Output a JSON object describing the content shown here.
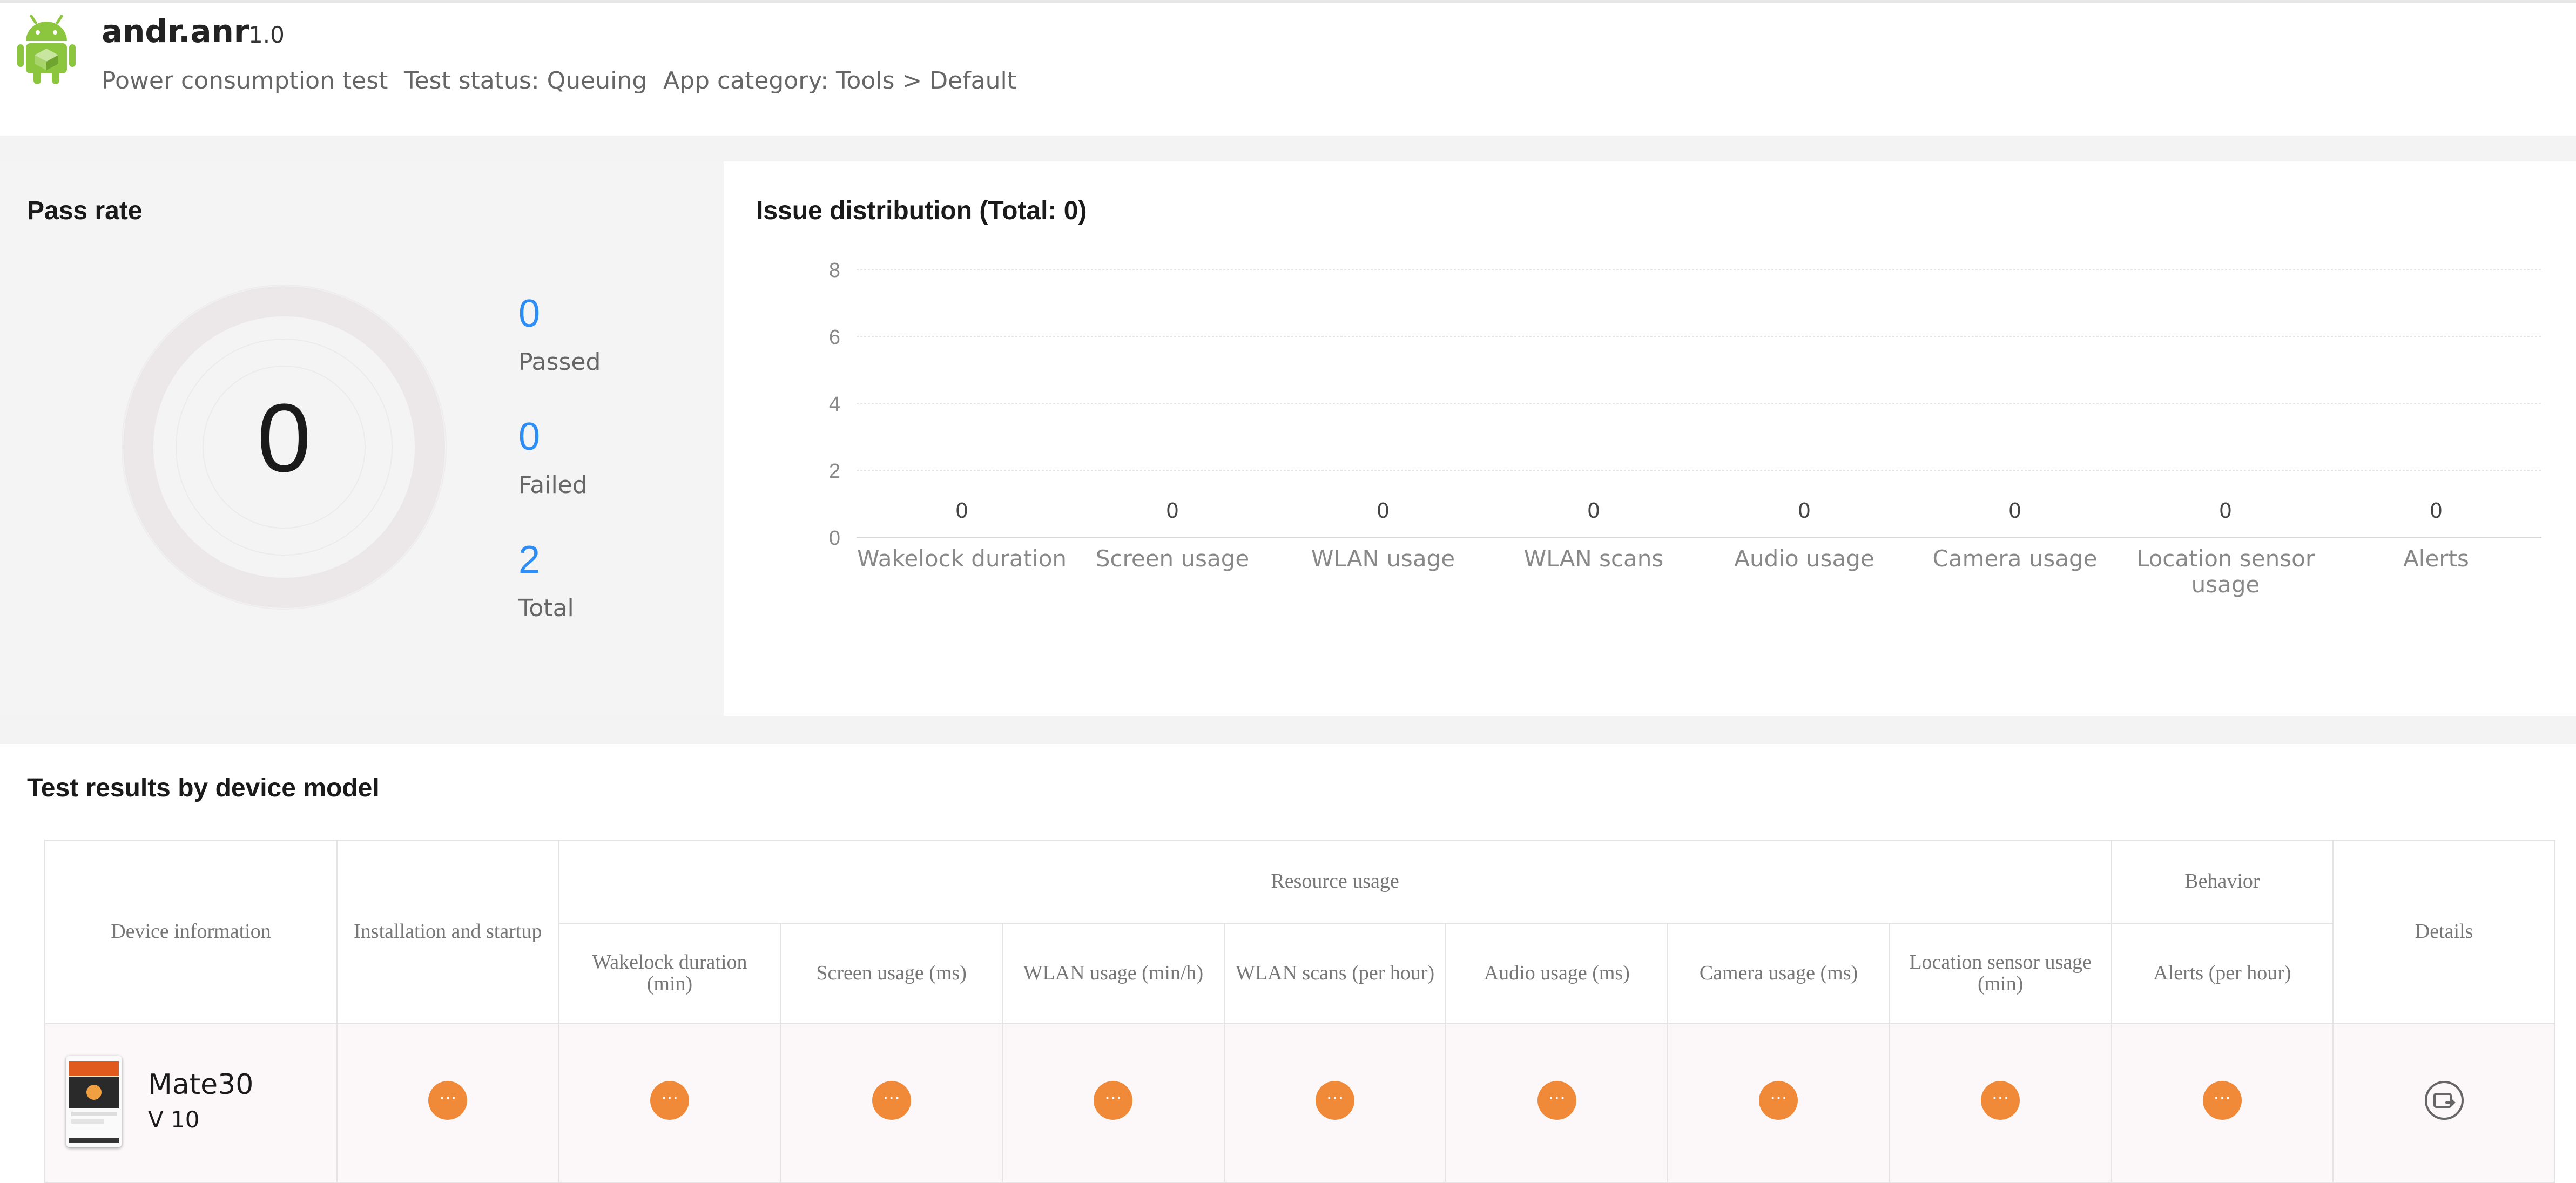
{
  "app": {
    "name": "andr.anr",
    "version": "1.0",
    "test_type": "Power consumption test",
    "test_status": "Test status: Queuing",
    "app_category": "App category: Tools > Default"
  },
  "pass_rate": {
    "title": "Pass rate",
    "rate": "0",
    "passed": "0",
    "passed_label": "Passed",
    "failed": "0",
    "failed_label": "Failed",
    "total": "2",
    "total_label": "Total"
  },
  "issue_chart": {
    "title": "Issue distribution (Total: 0)"
  },
  "chart_data": {
    "type": "bar",
    "title": "Issue distribution (Total: 0)",
    "categories": [
      "Wakelock duration",
      "Screen usage",
      "WLAN usage",
      "WLAN scans",
      "Audio usage",
      "Camera usage",
      "Location sensor usage",
      "Alerts"
    ],
    "values": [
      0,
      0,
      0,
      0,
      0,
      0,
      0,
      0
    ],
    "data_labels": [
      "0",
      "0",
      "0",
      "0",
      "0",
      "0",
      "0",
      "0"
    ],
    "yticks": [
      "0",
      "2",
      "4",
      "6",
      "8"
    ],
    "ylim": [
      0,
      8
    ],
    "grid": true,
    "xlabel": "",
    "ylabel": ""
  },
  "results": {
    "title": "Test results by device model",
    "headers": {
      "device_information": "Device information",
      "installation": "Installation and startup",
      "resource_usage": "Resource usage",
      "behavior": "Behavior",
      "details": "Details",
      "wakelock": "Wakelock duration (min)",
      "screen": "Screen usage (ms)",
      "wlan_usage": "WLAN usage (min/h)",
      "wlan_scans": "WLAN scans (per hour)",
      "audio": "Audio usage (ms)",
      "camera": "Camera usage (ms)",
      "location": "Location sensor usage (min)",
      "alerts": "Alerts (per hour)"
    },
    "rows": [
      {
        "device_name": "Mate30",
        "device_version": "V 10",
        "status_icon": "pending-dots-icon"
      }
    ]
  },
  "colors": {
    "accent_blue": "#2b8df5",
    "pending_orange": "#f08a38",
    "android_green": "#8cc63f"
  }
}
